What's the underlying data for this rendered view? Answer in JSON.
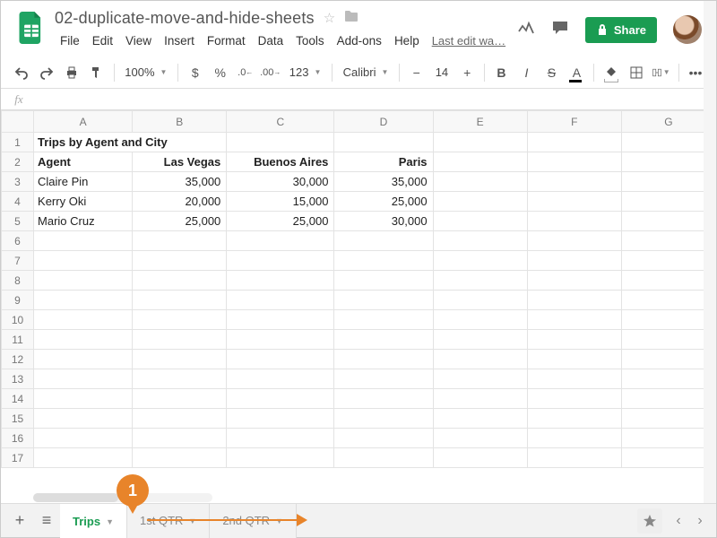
{
  "doc": {
    "title": "02-duplicate-move-and-hide-sheets",
    "last_edit": "Last edit wa…"
  },
  "menus": [
    "File",
    "Edit",
    "View",
    "Insert",
    "Format",
    "Data",
    "Tools",
    "Add-ons",
    "Help"
  ],
  "toolbar": {
    "zoom": "100%",
    "currency": "$",
    "percent": "%",
    "dec_less": ".0",
    "dec_more": ".00",
    "num_format": "123",
    "font": "Calibri",
    "size": "14",
    "more": "•••"
  },
  "share_label": "Share",
  "columns": [
    "A",
    "B",
    "C",
    "D",
    "E",
    "F",
    "G"
  ],
  "rows": {
    "r1": {
      "A": "Trips by Agent and City"
    },
    "r2": {
      "A": "Agent",
      "B": "Las Vegas",
      "C": "Buenos Aires",
      "D": "Paris"
    },
    "r3": {
      "A": "Claire Pin",
      "B": "35,000",
      "C": "30,000",
      "D": "35,000"
    },
    "r4": {
      "A": "Kerry Oki",
      "B": "20,000",
      "C": "15,000",
      "D": "25,000"
    },
    "r5": {
      "A": "Mario Cruz",
      "B": "25,000",
      "C": "25,000",
      "D": "30,000"
    }
  },
  "tabs": {
    "t1": "Trips",
    "t2": "1st QTR",
    "t3": "2nd QTR"
  },
  "callout": {
    "num": "1"
  }
}
